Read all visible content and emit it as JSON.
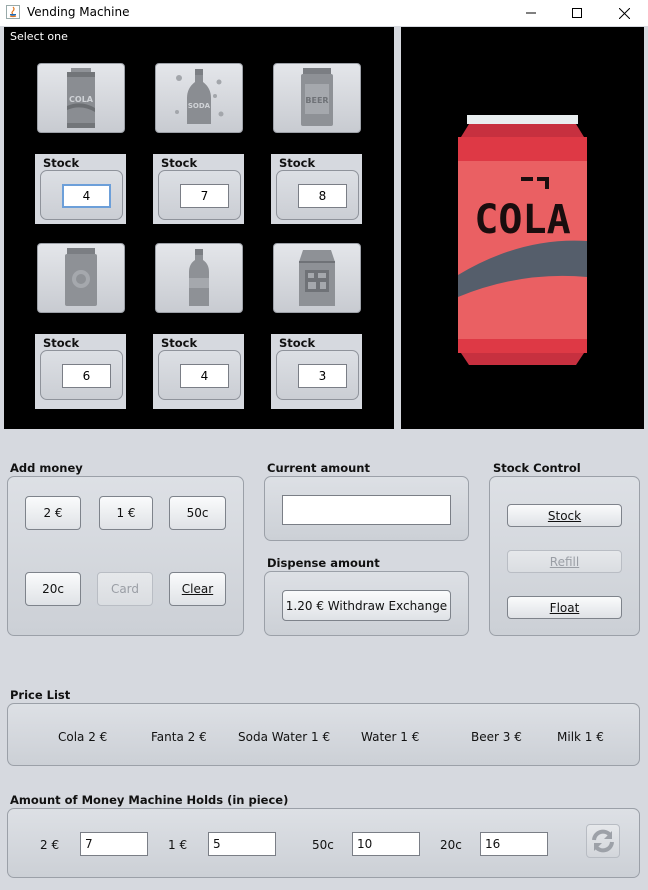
{
  "window": {
    "title": "Vending Machine"
  },
  "products": {
    "section_label": "Select one",
    "stock_label": "Stock",
    "items": [
      {
        "icon": "cola-can-icon",
        "stock": "4"
      },
      {
        "icon": "soda-bottle-icon",
        "stock": "7"
      },
      {
        "icon": "beer-can-icon",
        "stock": "8"
      },
      {
        "icon": "fanta-can-icon",
        "stock": "6"
      },
      {
        "icon": "water-bottle-icon",
        "stock": "4"
      },
      {
        "icon": "milk-carton-icon",
        "stock": "3"
      }
    ],
    "preview_icon": "cola-can-preview",
    "preview_text": "COLA"
  },
  "add_money": {
    "title": "Add money",
    "two_euro": "2 €",
    "one_euro": "1 €",
    "fifty_cent": "50c",
    "twenty_cent": "20c",
    "card": "Card",
    "clear": "Clear"
  },
  "current_amount": {
    "title": "Current amount",
    "value": ""
  },
  "dispense": {
    "title": "Dispense amount",
    "button": "1.20 € Withdraw Exchange"
  },
  "stock_control": {
    "title": "Stock Control",
    "stock": "Stock",
    "refill": "Refill",
    "float": "Float"
  },
  "price_list": {
    "title": "Price List",
    "items": [
      "Cola 2 €",
      "Fanta 2 €",
      "Soda Water 1 €",
      "Water 1 €",
      "Beer 3 €",
      "Milk 1 €"
    ]
  },
  "money_holds": {
    "title": "Amount of Money Machine Holds (in piece)",
    "coins": [
      {
        "label": "2 €",
        "value": "7"
      },
      {
        "label": "1 €",
        "value": "5"
      },
      {
        "label": "50c",
        "value": "10"
      },
      {
        "label": "20c",
        "value": "16"
      }
    ]
  },
  "colors": {
    "panel_bg": "#000000",
    "window_bg": "#d6d9df",
    "cola_red": "#e64a4f",
    "focus_blue": "#6c9fd9"
  }
}
